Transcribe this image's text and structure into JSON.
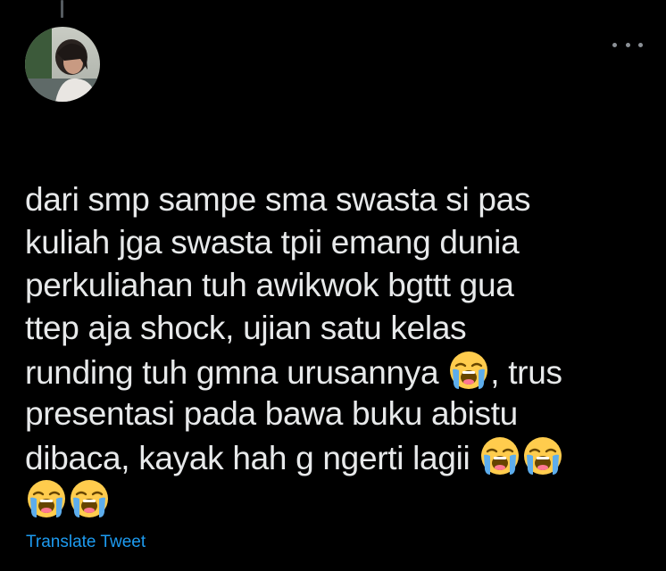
{
  "tweet": {
    "lines": [
      "dari smp sampe sma swasta si pas",
      "kuliah jga swasta tpii emang dunia",
      "perkuliahan tuh awikwok bgttt gua",
      "ttep aja shock, ujian satu kelas",
      "runding tuh gmna urusannya",
      ", trus",
      "presentasi pada bawa buku abistu",
      "dibaca, kayak hah g ngerti lagii"
    ],
    "emoji_name": "loudly-crying-face",
    "translate_label": "Translate Tweet"
  },
  "colors": {
    "background": "#000000",
    "text": "#e7e9ea",
    "link": "#1d9bf0",
    "icon_muted": "#8b9096"
  },
  "icons": {
    "more": "more-horizontal-icon",
    "avatar": "user-avatar"
  }
}
